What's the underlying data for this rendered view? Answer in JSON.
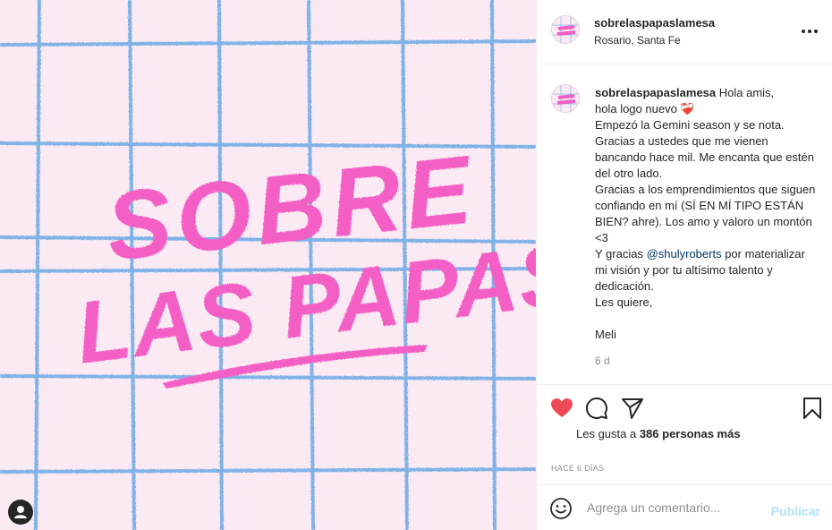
{
  "post": {
    "image": {
      "line1": "SOBRE",
      "line2": "LAS PAPAS",
      "colors": {
        "background": "#fbeaf3",
        "grid": "#6aa9e6",
        "lettering": "#f45fc5"
      }
    },
    "header": {
      "username": "sobrelaspapaslamesa",
      "location": "Rosario, Santa Fe",
      "more_icon": "more-horizontal-icon"
    },
    "caption": {
      "username": "sobrelaspapaslamesa",
      "text_before_mention": "Hola amis,\nhola logo nuevo ❤️‍🩹\nEmpezó la Gemini season y se nota.\nGracias a ustedes que me vienen bancando hace mil. Me encanta que estén del otro lado.\nGracias a los emprendimientos que siguen confiando en mí (SÍ EN MÍ TIPO ESTÁN BIEN? ahre). Los amo y valoro un montón <3\nY gracias ",
      "mention": "@shulyroberts",
      "text_after_mention": " por materializar mi visión y por tu altísimo talento y dedicación.\nLes quiere,\n\nMeli",
      "time": "6 d"
    },
    "likes": {
      "prefix": "Les gusta a ",
      "count": "386 personas más"
    },
    "time_ago": "HACE 6 DÍAS",
    "comment": {
      "placeholder": "Agrega un comentario...",
      "publish_label": "Publicar"
    },
    "colors": {
      "like": "#ed4956",
      "link": "#00376b",
      "muted": "#8e8e8e",
      "publish_disabled": "#b2dffc"
    }
  }
}
